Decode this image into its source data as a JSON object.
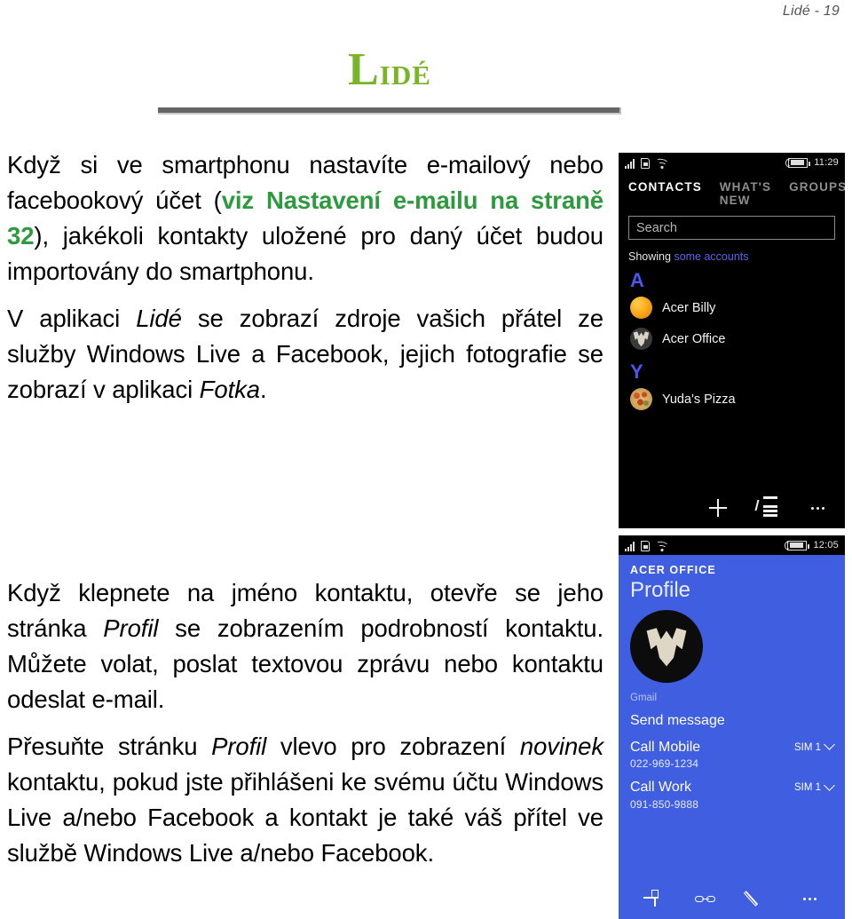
{
  "page": {
    "running_header": "Lidé - 19",
    "chapter_title_first": "L",
    "chapter_title_rest": "idé"
  },
  "body": {
    "paragraphs": [
      {
        "id": "p1",
        "runs": [
          {
            "text": "Když si ve smartphonu nastavíte e-mailový nebo facebookový účet (",
            "style": "plain"
          },
          {
            "text": "viz Nastavení e-mailu na straně 32",
            "style": "link"
          },
          {
            "text": "), jakékoli kontakty uložené pro daný účet budou importovány do smartphonu.",
            "style": "plain"
          }
        ]
      },
      {
        "id": "p2",
        "runs": [
          {
            "text": "V aplikaci ",
            "style": "plain"
          },
          {
            "text": "Lidé",
            "style": "italic"
          },
          {
            "text": " se zobrazí zdroje vašich přátel ze služby Windows Live a Facebook, jejich fotografie se zobrazí v aplikaci ",
            "style": "plain"
          },
          {
            "text": "Fotka",
            "style": "italic"
          },
          {
            "text": ".",
            "style": "plain"
          }
        ]
      },
      {
        "id": "p3",
        "runs": [
          {
            "text": "Když klepnete na jméno kontaktu, otevře se jeho stránka ",
            "style": "plain"
          },
          {
            "text": "Profil",
            "style": "italic"
          },
          {
            "text": " se zobrazením podrobností kontaktu. Můžete volat, poslat textovou zprávu nebo kontaktu odeslat e-mail.",
            "style": "plain"
          }
        ]
      },
      {
        "id": "p4",
        "runs": [
          {
            "text": "Přesuňte stránku ",
            "style": "plain"
          },
          {
            "text": "Profil",
            "style": "italic"
          },
          {
            "text": " vlevo pro zobrazení ",
            "style": "plain"
          },
          {
            "text": "novinek",
            "style": "italic"
          },
          {
            "text": " kontaktu, pokud jste přihlášeni ke svému účtu Windows Live a/nebo Facebook a kontakt je také váš přítel ve službě Windows Live a/nebo Facebook.",
            "style": "plain"
          }
        ]
      }
    ]
  },
  "screenshot_contacts": {
    "statusbar": {
      "clock": "11:29",
      "icons": [
        "signal-icon",
        "sim-card-icon",
        "wifi-icon",
        "battery-icon"
      ]
    },
    "tabs": [
      {
        "label": "CONTACTS",
        "active": true
      },
      {
        "label": "WHAT'S NEW",
        "active": false
      },
      {
        "label": "GROUPS",
        "active": false
      }
    ],
    "search_placeholder": "Search",
    "showing_label": "Showing",
    "showing_value": "some accounts",
    "groups": [
      {
        "letter": "A",
        "contacts": [
          {
            "name": "Acer Billy",
            "avatar": "avatar-orange"
          },
          {
            "name": "Acer Office",
            "avatar": "avatar-predator"
          }
        ]
      },
      {
        "letter": "Y",
        "contacts": [
          {
            "name": "Yuda's Pizza",
            "avatar": "avatar-pizza"
          }
        ]
      }
    ],
    "appbar": [
      "add-icon",
      "list-options-icon",
      "more-icon"
    ]
  },
  "screenshot_profile": {
    "statusbar": {
      "clock": "12:05",
      "icons": [
        "signal-icon",
        "sim-card-icon",
        "wifi-icon",
        "battery-icon"
      ]
    },
    "eyebrow": "ACER OFFICE",
    "title": "Profile",
    "avatar": "avatar-predator-large",
    "email_label": "Gmail",
    "actions": [
      {
        "title": "Send message",
        "sub": "",
        "sim": ""
      },
      {
        "title": "Call Mobile",
        "sub": "022-969-1234",
        "sim": "SIM 1"
      },
      {
        "title": "Call Work",
        "sub": "091-850-9888",
        "sim": "SIM 1"
      }
    ],
    "appbar": [
      "pin-icon",
      "link-icon",
      "edit-icon",
      "more-icon"
    ]
  },
  "colors": {
    "title_green": "#79b528",
    "link_green": "#2d9a3e",
    "phone_blue": "#3f5ee0",
    "accent_blue": "#4a56ef"
  }
}
